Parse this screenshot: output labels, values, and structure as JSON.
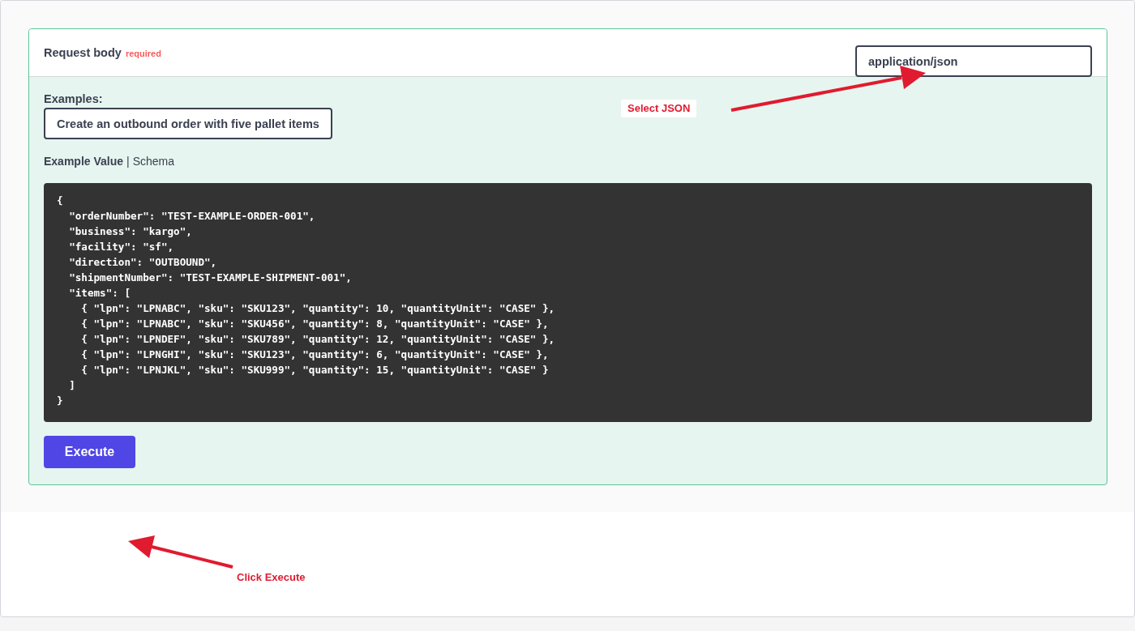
{
  "request_body": {
    "title": "Request body",
    "required_label": "required",
    "content_type": {
      "value": "application/json"
    },
    "examples": {
      "label": "Examples:",
      "value": "Create an outbound order with five pallet items"
    },
    "tabs": [
      {
        "label": "Example Value",
        "selected": true
      },
      {
        "label": "Schema",
        "selected": false
      }
    ],
    "tab_separator": "|",
    "code_lines": [
      "{",
      "  \"orderNumber\": \"TEST-EXAMPLE-ORDER-001\",",
      "  \"business\": \"kargo\",",
      "  \"facility\": \"sf\",",
      "  \"direction\": \"OUTBOUND\",",
      "  \"shipmentNumber\": \"TEST-EXAMPLE-SHIPMENT-001\",",
      "  \"items\": [",
      "    { \"lpn\": \"LPNABC\", \"sku\": \"SKU123\", \"quantity\": 10, \"quantityUnit\": \"CASE\" },",
      "    { \"lpn\": \"LPNABC\", \"sku\": \"SKU456\", \"quantity\": 8, \"quantityUnit\": \"CASE\" },",
      "    { \"lpn\": \"LPNDEF\", \"sku\": \"SKU789\", \"quantity\": 12, \"quantityUnit\": \"CASE\" },",
      "    { \"lpn\": \"LPNGHI\", \"sku\": \"SKU123\", \"quantity\": 6, \"quantityUnit\": \"CASE\" },",
      "    { \"lpn\": \"LPNJKL\", \"sku\": \"SKU999\", \"quantity\": 15, \"quantityUnit\": \"CASE\" }",
      "  ]",
      "}"
    ],
    "execute_button": "Execute"
  },
  "annotations": [
    {
      "text": "Select JSON"
    },
    {
      "text": "Click Execute"
    }
  ]
}
